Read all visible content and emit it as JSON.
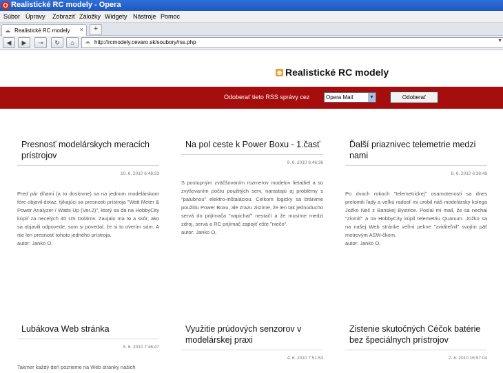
{
  "window": {
    "title": "Realistické RC modely - Opera"
  },
  "menu": [
    "Súbor",
    "Úpravy",
    "Zobraziť",
    "Záložky",
    "Widgety",
    "Nástroje",
    "Pomoc"
  ],
  "tab": {
    "label": "Realistické RC modely",
    "close": "×",
    "new_tab": "+"
  },
  "address": {
    "url": "http://rcmodely.cevaro.sk/soubory/rss.php"
  },
  "page": {
    "heading": "Realistické RC modely",
    "subscribe": {
      "label": "Odoberať tieto RSS správy cez",
      "reader": "Opera Mail",
      "button": "Odoberať"
    }
  },
  "articles": [
    {
      "title": "Presnosť modelárskych meracích prístrojov",
      "date": "10. 6. 2010 6:48:33",
      "body": "Pred pár dňami (a to doslovne) sa na jednom modelárskom fóre objavil dotaz, týkajúci sa presnosti prístroja \"Watt Meter & Power Analyzer / Watts Up (Ver.2)\", ktorý sa dá na HobbyCity kúpiť za necelých 40 US Dolárov. Zaujalo ma to a skôr, ako sa objavili odpovede, som si povedal, že si to overím sám. A nie len presnosť tohoto jedného prístroja.",
      "author": "autor: Janko O."
    },
    {
      "title": "Na pol ceste k Power Boxu - 1.časť",
      "date": "9. 6. 2010 6:46:36",
      "body": "S postupným zväčšovaním rozmerov modelov lietadiel a so zvyšovaním počtu použitých serv, narastajú aj problémy s \"palubnou\" elektro-inštaláciou. Celkom logicky sa bránime použitiu Power Boxu, ale zrazu zistíme, že len tak jednoducho servá do prijímača \"napichať\" nestačí a že musíme medzi zdroj, servá a RC prijímač zapojiť ešte \"niečo\".",
      "author": "autor: Janko O."
    },
    {
      "title": "Ďalší priaznivec telemetrie medzi nami",
      "date": "8. 6. 2010 6:38:48",
      "body": "Po dvoch rokoch \"telemetrickej\" osamotenosti sa dnes prelomili ľady a veľkú radosť mi urobil náš modelársky kolega Jožko Neč z Banskej Bystrice. Poslal mi mail, že sa nechal \"zlomiť\" a na HobbyCity kúpil telemetriu Quanum. Jožko sa na našej Web stránke veľmi pekne \"zviditeľnil\" svojím päť metrovým ASW-čkom.",
      "author": "autor: Janko O."
    },
    {
      "title": "Lubákova Web stránka",
      "date": "5. 6. 2010 7:46:47",
      "body": "Takmer každý deň pozrieme na Web stránky našich",
      "author": ""
    },
    {
      "title": "Využitie prúdových senzorov v modelárskej praxi",
      "date": "4. 6. 2010 7:51:53",
      "body": "",
      "author": ""
    },
    {
      "title": "Zistenie skutočných Céčok batérie bez špeciálnych prístrojov",
      "date": "2. 6. 2010 16:57:04",
      "body": "",
      "author": ""
    }
  ]
}
